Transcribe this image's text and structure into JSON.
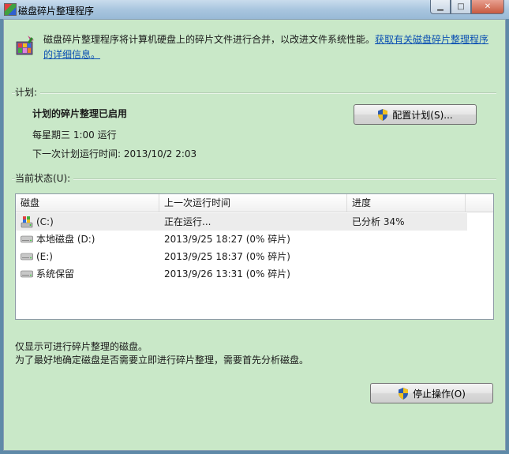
{
  "window": {
    "title": "磁盘碎片整理程序"
  },
  "header": {
    "description": "磁盘碎片整理程序将计算机硬盘上的碎片文件进行合并，以改进文件系统性能。",
    "link_text": "获取有关磁盘碎片整理程序的详细信息。"
  },
  "schedule": {
    "section_label": "计划:",
    "status": "计划的碎片整理已启用",
    "frequency": "每星期三  1:00 运行",
    "next_run": "下一次计划运行时间: 2013/10/2 2:03",
    "configure_button": "配置计划(S)..."
  },
  "current_status": {
    "section_label": "当前状态(U):",
    "columns": [
      "磁盘",
      "上一次运行时间",
      "进度"
    ],
    "rows": [
      {
        "disk": "(C:)",
        "last_run": "正在运行...",
        "progress": "已分析 34%",
        "icon": "system-drive-icon"
      },
      {
        "disk": "本地磁盘 (D:)",
        "last_run": "2013/9/25 18:27 (0% 碎片)",
        "progress": "",
        "icon": "drive-icon"
      },
      {
        "disk": "(E:)",
        "last_run": "2013/9/25 18:37 (0% 碎片)",
        "progress": "",
        "icon": "drive-icon"
      },
      {
        "disk": "系统保留",
        "last_run": "2013/9/26 13:31 (0% 碎片)",
        "progress": "",
        "icon": "drive-icon"
      }
    ]
  },
  "notes": {
    "line1": "仅显示可进行碎片整理的磁盘。",
    "line2": "为了最好地确定磁盘是否需要立即进行碎片整理，需要首先分析磁盘。"
  },
  "actions": {
    "stop_button": "停止操作(O)"
  },
  "colors": {
    "panel": "#c9e8c8",
    "link": "#0a4fb2",
    "selection": "#ececec"
  }
}
